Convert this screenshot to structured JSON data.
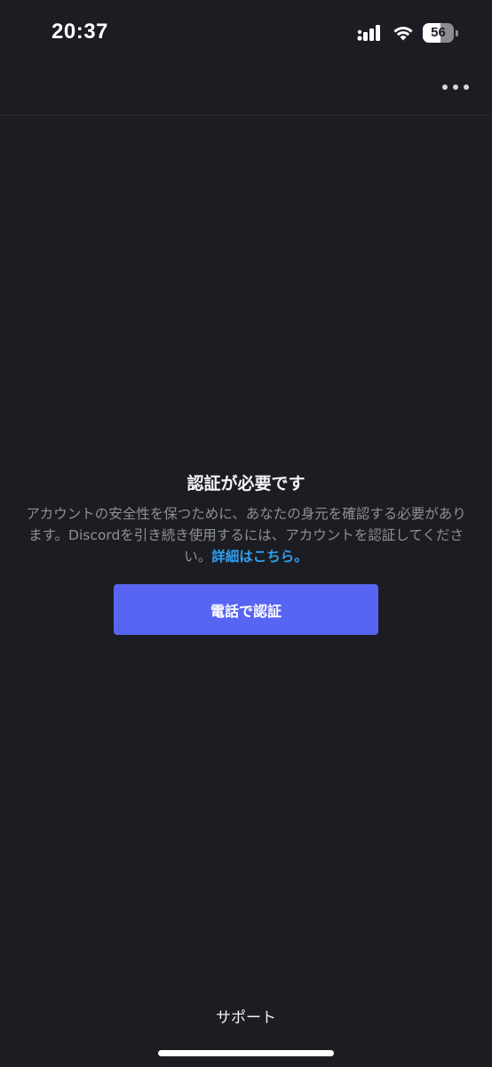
{
  "status_bar": {
    "time": "20:37",
    "battery_level": "56",
    "battery_percent": 56
  },
  "icons": {
    "signal": "cellular-signal-icon",
    "wifi": "wifi-icon",
    "battery": "battery-icon",
    "more": "more-horizontal-icon"
  },
  "colors": {
    "background": "#1c1d22",
    "accent": "#5865f2",
    "link": "#2f9ff0",
    "muted_text": "#8e9097"
  },
  "verification": {
    "title": "認証が必要です",
    "description_before_link": "アカウントの安全性を保つために、あなたの身元を確認する必要があります。Discordを引き続き使用するには、アカウントを認証してください。",
    "learn_more_link": "詳細はこちら。",
    "verify_button_label": "電話で認証"
  },
  "footer": {
    "support_label": "サポート"
  }
}
